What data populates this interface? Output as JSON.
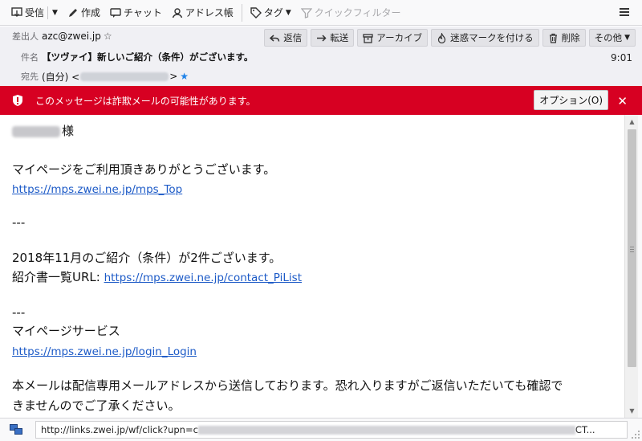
{
  "toolbar": {
    "get_messages": "受信",
    "write": "作成",
    "chat": "チャット",
    "address_book": "アドレス帳",
    "tag": "タグ",
    "quick_filter": "クイックフィルター"
  },
  "header": {
    "from_label": "差出人",
    "from_value": "azc@zwei.jp",
    "subject_label": "件名",
    "subject_value": "【ツヴァイ】新しいご紹介（条件）がございます。",
    "to_label": "宛先",
    "to_prefix": "(自分) <",
    "to_suffix": ">",
    "time": "9:01",
    "actions": {
      "reply": "返信",
      "forward": "転送",
      "archive": "アーカイブ",
      "junk": "迷惑マークを付ける",
      "delete": "削除",
      "more": "その他"
    }
  },
  "scam_bar": {
    "message": "このメッセージは詐欺メールの可能性があります。",
    "options_button": "オプション(O)"
  },
  "body": {
    "greeting_suffix": "様",
    "line1": "マイページをご利用頂きありがとうございます。",
    "link1": "https://mps.zwei.ne.jp/mps_Top",
    "sep1": "---",
    "line2": "2018年11月のご紹介（条件）が2件ございます。",
    "line3_prefix": "紹介書一覧URL: ",
    "link2": "https://mps.zwei.ne.jp/contact_PiList",
    "sep2": "---",
    "line4": "マイページサービス",
    "link3": "https://mps.zwei.ne.jp/login_Login",
    "line5": "本メールは配信専用メールアドレスから送信しております。恐れ入りますがご返信いただいても確認で",
    "line6": "きませんのでご了承ください。"
  },
  "status": {
    "url_prefix": "http://links.zwei.jp/wf/click?upn=c",
    "url_suffix": "CT..."
  },
  "colors": {
    "scam_red": "#d70022",
    "link_blue": "#1c5ac7",
    "star_blue": "#1e82e8"
  }
}
